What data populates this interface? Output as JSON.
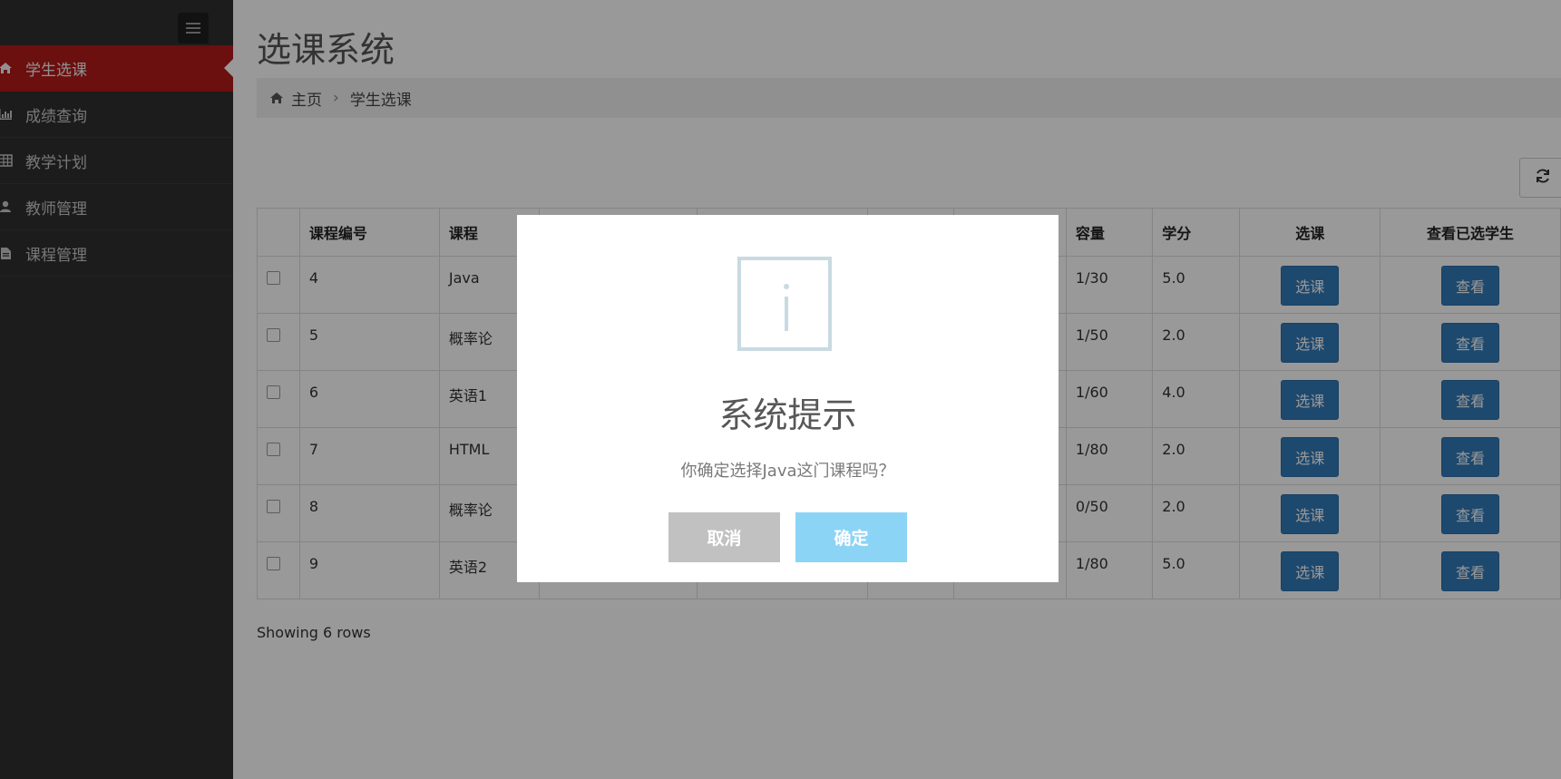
{
  "sidebar": {
    "items": [
      {
        "label": "学生选课",
        "icon": "home-icon",
        "active": true
      },
      {
        "label": "成绩查询",
        "icon": "bar-chart-icon",
        "active": false
      },
      {
        "label": "教学计划",
        "icon": "table-icon",
        "active": false
      },
      {
        "label": "教师管理",
        "icon": "user-icon",
        "active": false
      },
      {
        "label": "课程管理",
        "icon": "file-icon",
        "active": false
      }
    ]
  },
  "header": {
    "title": "选课系统",
    "breadcrumb": {
      "home": "主页",
      "current": "学生选课"
    }
  },
  "table": {
    "headers": [
      "课程编号",
      "课程",
      "",
      "",
      "",
      "",
      "容量",
      "学分",
      "选课",
      "查看已选学生"
    ],
    "rows": [
      {
        "id": "4",
        "course": "Java",
        "capacity": "1/30",
        "credit": "5.0",
        "select": "选课",
        "view": "查看"
      },
      {
        "id": "5",
        "course": "概率论",
        "capacity": "1/50",
        "credit": "2.0",
        "select": "选课",
        "view": "查看"
      },
      {
        "id": "6",
        "course": "英语1",
        "capacity": "1/60",
        "credit": "4.0",
        "select": "选课",
        "view": "查看"
      },
      {
        "id": "7",
        "course": "HTML",
        "capacity": "1/80",
        "credit": "2.0",
        "select": "选课",
        "view": "查看"
      },
      {
        "id": "8",
        "course": "概率论",
        "capacity": "0/50",
        "credit": "2.0",
        "select": "选课",
        "view": "查看"
      },
      {
        "id": "9",
        "course": "英语2",
        "capacity": "1/80",
        "credit": "5.0",
        "select": "选课",
        "view": "查看"
      }
    ],
    "footer": "Showing 6 rows"
  },
  "modal": {
    "icon": "info-icon",
    "title": "系统提示",
    "message": "你确定选择Java这门课程吗？",
    "cancel_label": "取消",
    "confirm_label": "确定"
  },
  "colors": {
    "accent": "#b3191a",
    "primary": "#337ab7",
    "confirm": "#8cd4f5",
    "cancel": "#c1c1c1"
  }
}
